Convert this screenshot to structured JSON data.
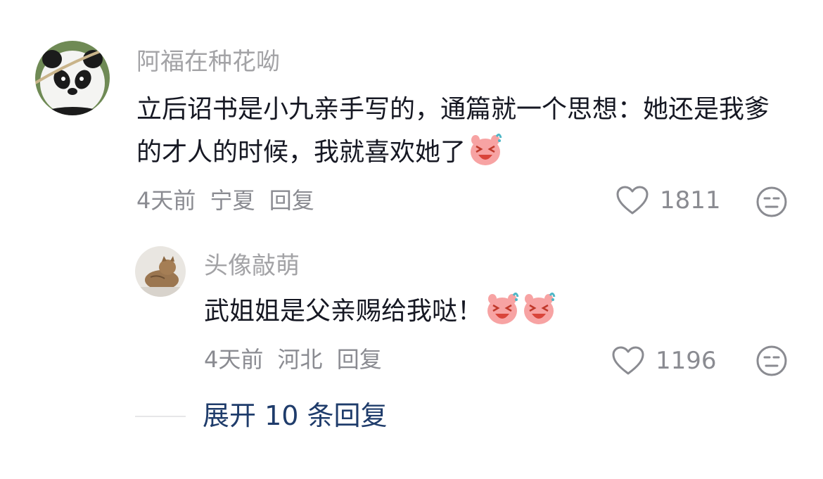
{
  "comment": {
    "username": "阿福在种花呦",
    "text": "立后诏书是小九亲手写的，通篇就一个思想：她还是我爹的才人的时候，我就喜欢她了",
    "time": "4天前",
    "location": "宁夏",
    "reply_label": "回复",
    "likes": "1811",
    "avatar_icon": "panda-avatar",
    "emoji": "laughing-crying-emoji"
  },
  "reply": {
    "username": "头像敲萌",
    "text": "武姐姐是父亲赐给我哒！",
    "time": "4天前",
    "location": "河北",
    "reply_label": "回复",
    "likes": "1196",
    "avatar_icon": "cat-avatar",
    "emoji_count": 2
  },
  "expand_label": "展开 10 条回复",
  "colors": {
    "username": "#a3a3a6",
    "text": "#161823",
    "meta": "#8a8b91",
    "expand": "#1f3c6b"
  }
}
